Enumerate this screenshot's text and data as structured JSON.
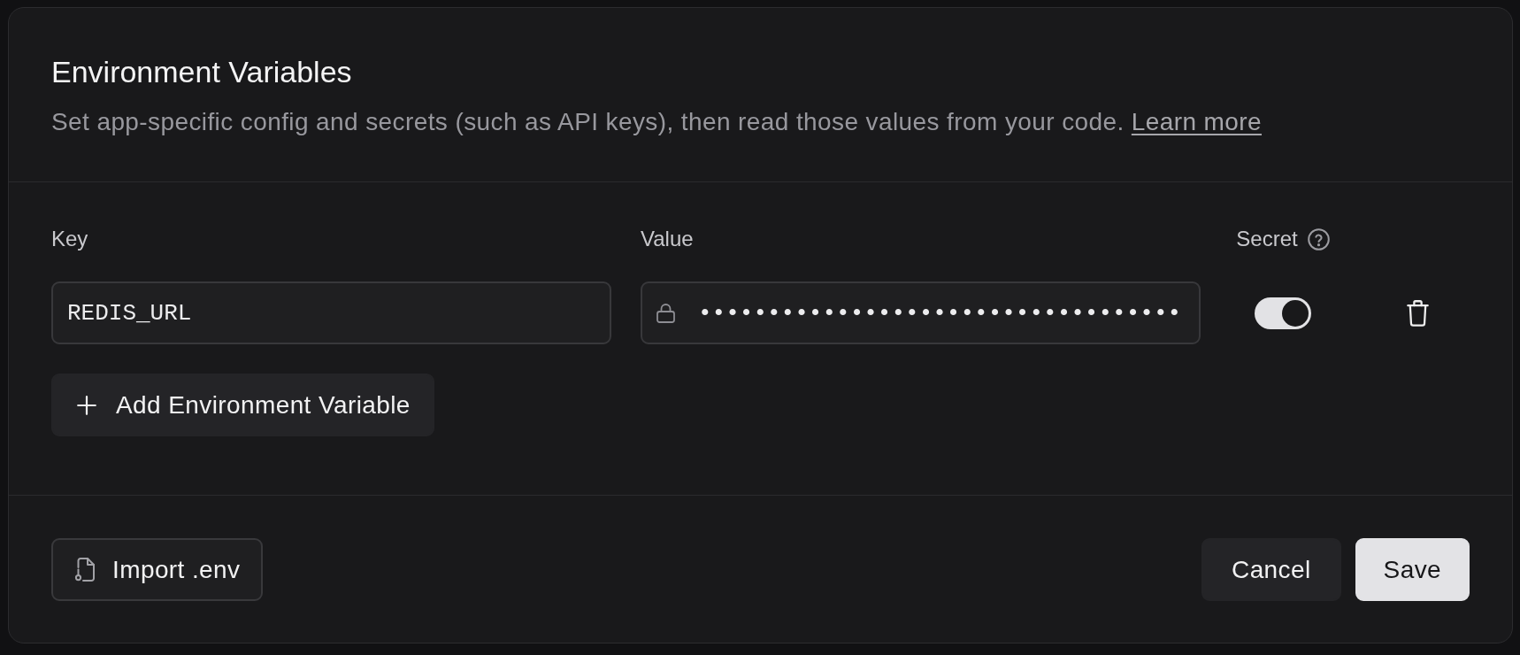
{
  "dialog": {
    "title": "Environment Variables",
    "description": "Set app-specific config and secrets (such as API keys), then read those values from your code.",
    "link": "Learn more"
  },
  "columns": {
    "key": "Key",
    "value": "Value",
    "secret": "Secret"
  },
  "variables": [
    {
      "key": "REDIS_URL",
      "value": "•••••••••••••••••••••••••••••••••••",
      "secret": true
    }
  ],
  "add_button": "Add Environment Variable",
  "footer": {
    "import_button": "Import .env",
    "cancel_button": "Cancel",
    "save_button": "Save"
  }
}
